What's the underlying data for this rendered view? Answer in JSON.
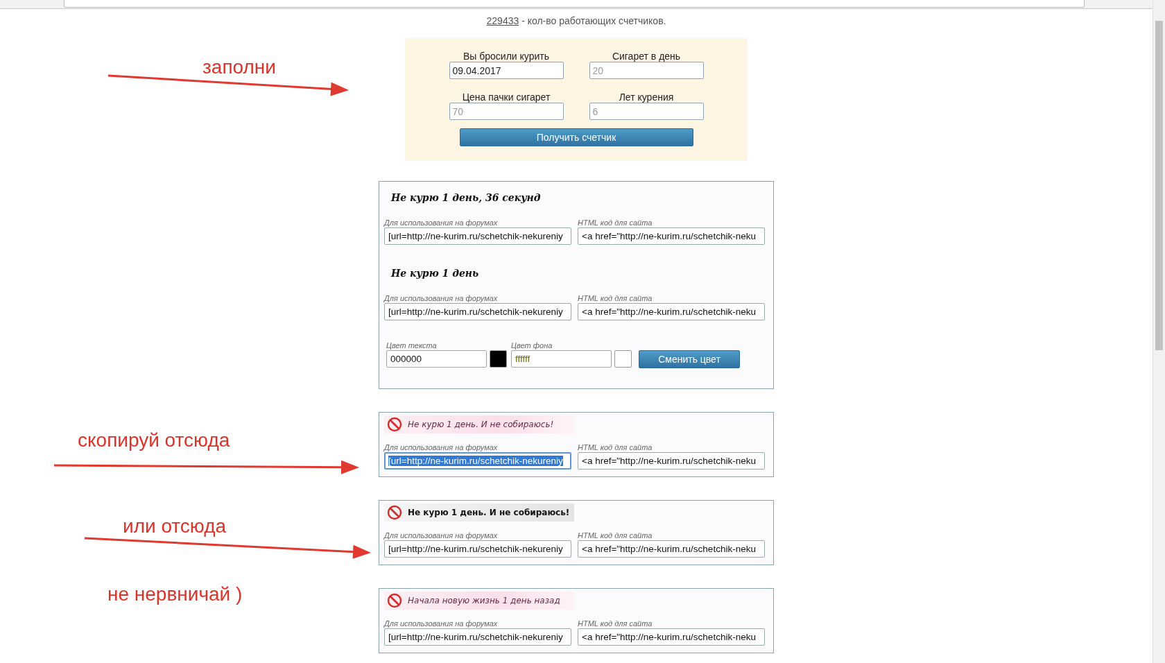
{
  "counter": {
    "value": "229433",
    "text": " - кол-во работающих счетчиков."
  },
  "form": {
    "fields": [
      {
        "label": "Вы бросили курить",
        "value": "09.04.2017"
      },
      {
        "label": "Сигарет в день",
        "placeholder": "20"
      },
      {
        "label": "Цена пачки сигарет",
        "placeholder": "70"
      },
      {
        "label": "Лет курения",
        "placeholder": "6"
      }
    ],
    "button": "Получить счетчик"
  },
  "counter_panel": {
    "items": [
      {
        "title": "Не курю 1 день, 36 секунд",
        "forum_label": "Для использования на форумах",
        "forum_value": "[url=http://ne-kurim.ru/schetchik-nekureniy",
        "html_label": "HTML код для сайта",
        "html_value": "<a href=\"http://ne-kurim.ru/schetchik-neku"
      },
      {
        "title": "Не курю 1 день",
        "forum_label": "Для использования на форумах",
        "forum_value": "[url=http://ne-kurim.ru/schetchik-nekureniy",
        "html_label": "HTML код для сайта",
        "html_value": "<a href=\"http://ne-kurim.ru/schetchik-neku"
      }
    ],
    "colors": [
      {
        "label": "Цвет текста",
        "value": "000000",
        "color": "#000000"
      },
      {
        "label": "Цвет фона",
        "value": "ffffff",
        "color": "#ffffff"
      }
    ],
    "button": "Сменить цвет"
  },
  "banners": [
    {
      "kind": "pink",
      "title": "Не курю 1 день. И не собираюсь!",
      "forum_label": "Для использования на форумах",
      "forum_value": "[url=http://ne-kurim.ru/schetchik-nekureniy",
      "forum_selected": true,
      "html_label": "HTML код для сайта",
      "html_value": "<a href=\"http://ne-kurim.ru/schetchik-neku"
    },
    {
      "kind": "grey",
      "title": "Не курю 1 день. И не собираюсь!",
      "forum_label": "Для использования на форумах",
      "forum_value": "[url=http://ne-kurim.ru/schetchik-nekureniy",
      "forum_selected": false,
      "html_label": "HTML код для сайта",
      "html_value": "<a href=\"http://ne-kurim.ru/schetchik-neku"
    },
    {
      "kind": "pink",
      "title": "Начала новую жизнь 1 день назад",
      "forum_label": "Для использования на форумах",
      "forum_value": "[url=http://ne-kurim.ru/schetchik-nekureniy",
      "forum_selected": false,
      "html_label": "HTML код для сайта",
      "html_value": "<a href=\"http://ne-kurim.ru/schetchik-neku"
    }
  ],
  "annotations": [
    {
      "text": "заполни",
      "arrow": true
    },
    {
      "text": "скопируй отсюда",
      "arrow": true
    },
    {
      "text": "или отсюда",
      "arrow": true
    },
    {
      "text": "не нервничай )",
      "arrow": false
    }
  ]
}
